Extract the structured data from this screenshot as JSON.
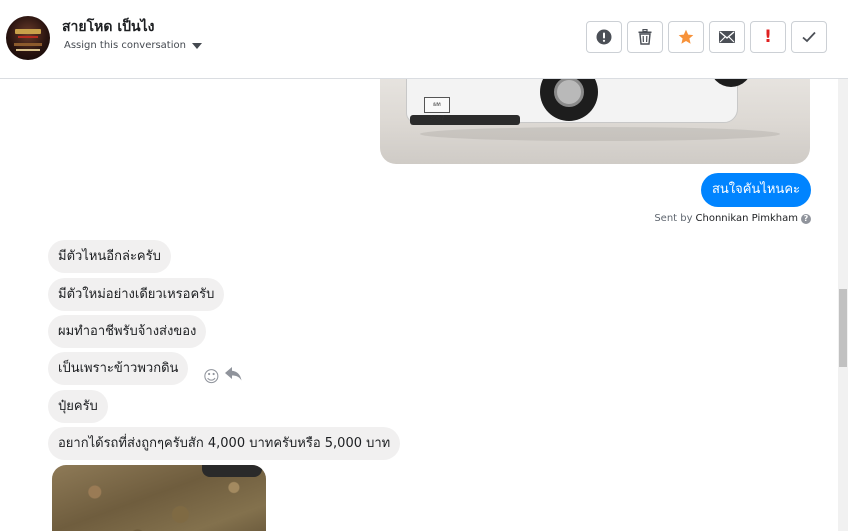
{
  "header": {
    "conversation_name": "สายโหด เป็นไง",
    "assign_label": "Assign this conversation"
  },
  "toolbar": {
    "buttons": [
      {
        "name": "alert-button",
        "icon": "alert-circle-icon"
      },
      {
        "name": "delete-button",
        "icon": "trash-icon"
      },
      {
        "name": "star-button",
        "icon": "star-icon",
        "color": "#f7923a"
      },
      {
        "name": "email-button",
        "icon": "envelope-icon"
      },
      {
        "name": "important-button",
        "icon": "exclamation-icon",
        "text": "!",
        "color": "#e02020"
      },
      {
        "name": "done-button",
        "icon": "check-icon"
      }
    ]
  },
  "thread": {
    "image_plate_text": "ผท 3067",
    "outgoing": {
      "text": "สนใจคันไหนคะ",
      "sent_by_prefix": "Sent by",
      "sent_by_name": "Chonnikan Pimkham",
      "bubble_color": "#0084ff"
    },
    "incoming": [
      "มีตัวไหนอีกล่ะครับ",
      "มีตัวใหม่อย่างเดียวเหรอครับ",
      "ผมทำอาชีพรับจ้างส่งของ",
      "เป็นเพราะข้าวพวกดิน",
      "ปุ๋ยครับ",
      "อยากได้รถที่ส่งถูกๆครับสัก 4,000 บาทครับหรือ 5,000 บาท"
    ]
  }
}
